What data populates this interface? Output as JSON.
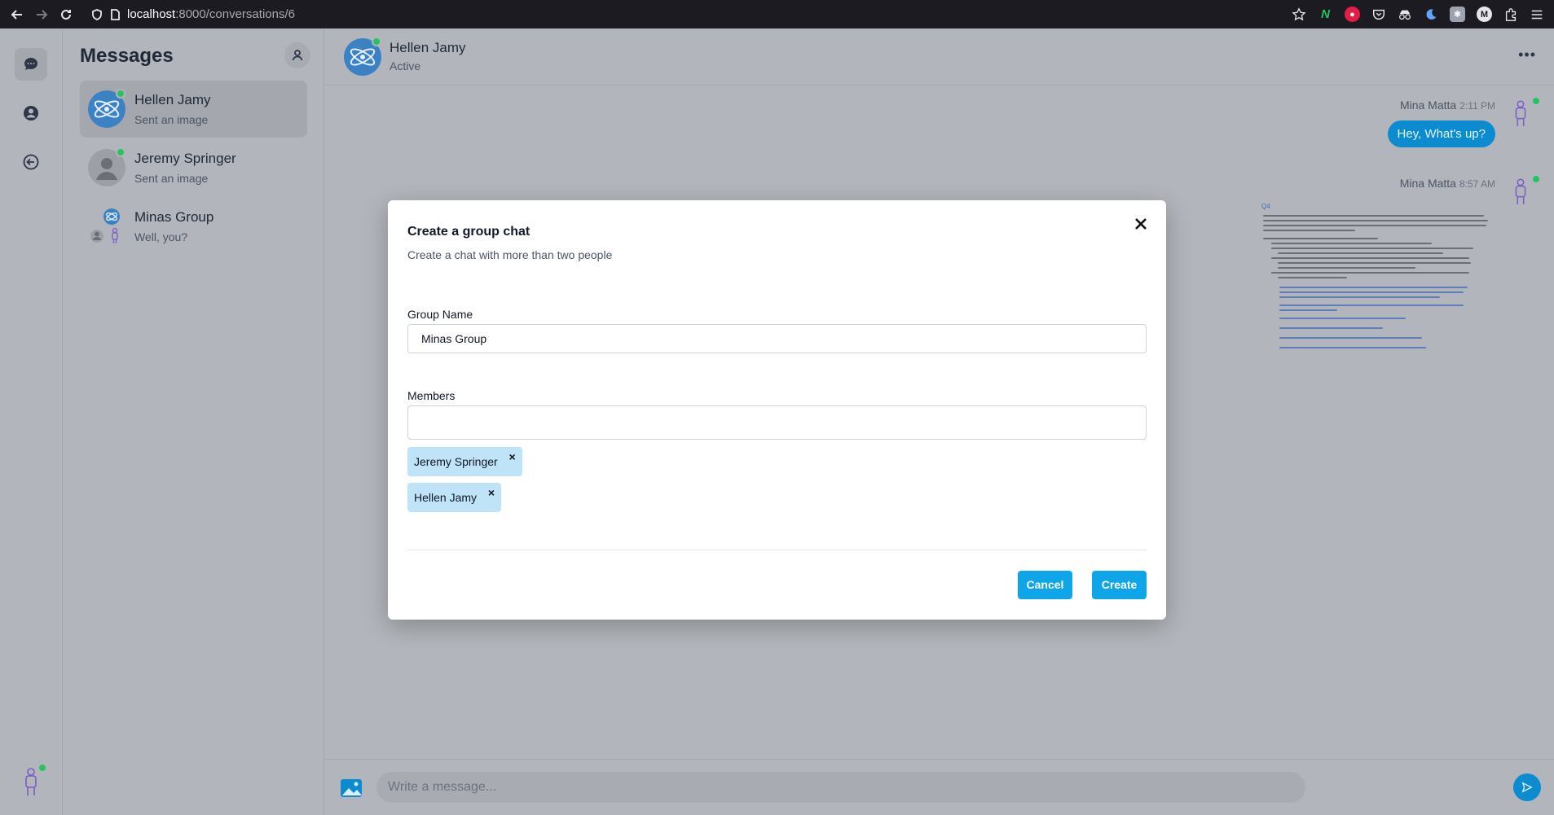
{
  "browser": {
    "url_host": "localhost",
    "url_rest": ":8000/conversations/6"
  },
  "rail": {
    "items": [
      {
        "icon": "chat-bubble-icon"
      },
      {
        "icon": "user-circle-icon"
      },
      {
        "icon": "logout-arrow-icon"
      }
    ]
  },
  "sidebar": {
    "title": "Messages",
    "conversations": [
      {
        "name": "Hellen Jamy",
        "preview": "Sent an image"
      },
      {
        "name": "Jeremy Springer",
        "preview": "Sent an image"
      },
      {
        "name": "Minas Group",
        "preview": "Well, you?"
      }
    ]
  },
  "chat": {
    "contact_name": "Hellen Jamy",
    "contact_status": "Active",
    "messages": [
      {
        "sender": "Mina Matta",
        "time": "2:11 PM",
        "text": "Hey, What's up?"
      },
      {
        "sender": "Mina Matta",
        "time": "8:57 AM"
      }
    ],
    "document_heading": "Q4",
    "composer_placeholder": "Write a message..."
  },
  "modal": {
    "title": "Create a group chat",
    "description": "Create a chat with more than two people",
    "group_name_label": "Group Name",
    "group_name_value": "Minas Group",
    "members_label": "Members",
    "members": [
      "Jeremy Springer",
      "Hellen Jamy"
    ],
    "remove_glyph": "×",
    "cancel_label": "Cancel",
    "create_label": "Create"
  },
  "colors": {
    "accent": "#0ea5e9",
    "bubble": "#0b8bd0",
    "online": "#22c55e",
    "chip": "#bfe3f7"
  }
}
